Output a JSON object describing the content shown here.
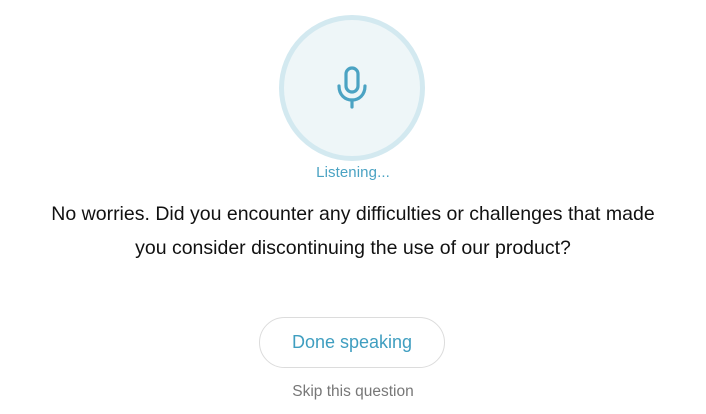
{
  "recorder": {
    "icon": "microphone-icon",
    "status_text": "Listening...",
    "accent_color": "#4ba3c3"
  },
  "question": {
    "line1": "No worries. Did you encounter any difficulties or challenges that made",
    "line2": "you consider discontinuing the use of our product?"
  },
  "actions": {
    "done_label": "Done speaking",
    "skip_label": "Skip this question"
  }
}
